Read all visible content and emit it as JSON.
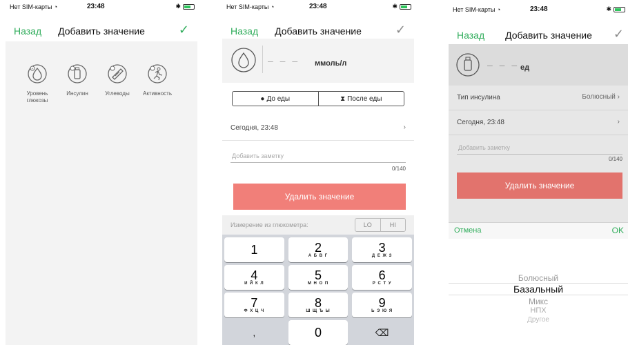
{
  "status": {
    "carrier": "Нет SIM-карты",
    "time": "23:48"
  },
  "nav": {
    "back": "Назад",
    "title": "Добавить значение"
  },
  "categories": [
    {
      "label": "Уровень глюкозы",
      "icon": "glucose-drop-icon"
    },
    {
      "label": "Инсулин",
      "icon": "insulin-vial-icon"
    },
    {
      "label": "Углеводы",
      "icon": "carbs-icon"
    },
    {
      "label": "Активность",
      "icon": "activity-runner-icon"
    }
  ],
  "glucose": {
    "dashes": "– – –",
    "unit": "ммоль/л",
    "meal_before": "До еды",
    "meal_after": "После еды",
    "datetime": "Сегодня, 23:48",
    "note_placeholder": "Добавить заметку",
    "note_counter": "0/140",
    "delete": "Удалить значение",
    "meter_label": "Измерение из глюкометра:",
    "lo": "LO",
    "hi": "HI"
  },
  "keypad": [
    {
      "digit": "1",
      "sub": ""
    },
    {
      "digit": "2",
      "sub": "А Б В Г"
    },
    {
      "digit": "3",
      "sub": "Д Е Ж З"
    },
    {
      "digit": "4",
      "sub": "И Й К Л"
    },
    {
      "digit": "5",
      "sub": "М Н О П"
    },
    {
      "digit": "6",
      "sub": "Р С Т У"
    },
    {
      "digit": "7",
      "sub": "Ф Х Ц Ч"
    },
    {
      "digit": "8",
      "sub": "Ш Щ Ъ Ы"
    },
    {
      "digit": "9",
      "sub": "Ь Э Ю Я"
    }
  ],
  "keypad_extra": {
    "comma": ",",
    "zero": "0",
    "backspace": "⌫"
  },
  "insulin": {
    "dashes": "– – –",
    "unit": "ед",
    "type_label": "Тип инсулина",
    "type_value": "Болюсный",
    "datetime": "Сегодня, 23:48",
    "note_placeholder": "Добавить заметку",
    "note_counter": "0/140",
    "delete": "Удалить значение",
    "cancel": "Отмена",
    "ok": "OK",
    "options": [
      "Болюсный",
      "Базальный",
      "Микс",
      "НПХ",
      "Другое"
    ],
    "selected_index": 1
  },
  "colors": {
    "accent": "#31ad5c",
    "delete": "#f17f79"
  }
}
